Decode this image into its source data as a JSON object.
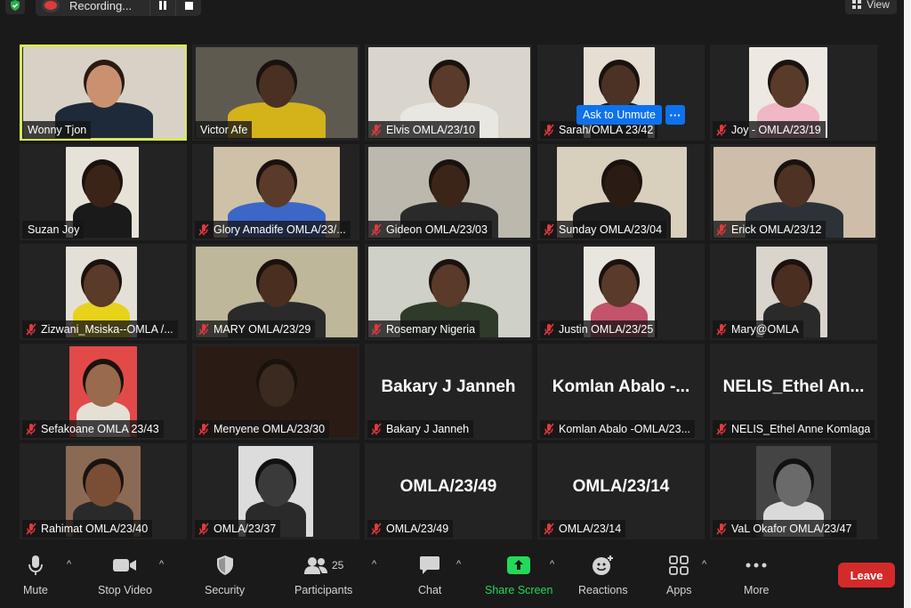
{
  "top_bar": {
    "recording_label": "Recording...",
    "view_label": "View"
  },
  "participants": [
    {
      "name": "Wonny Tjon",
      "muted": false,
      "active": true
    },
    {
      "name": "Victor Afe",
      "muted": false
    },
    {
      "name": "Elvis OMLA/23/10",
      "muted": true
    },
    {
      "name": "Sarah/OMLA 23/42",
      "muted": true
    },
    {
      "name": "Joy - OMLA/23/19",
      "muted": true
    },
    {
      "name": "Suzan Joy",
      "muted": false
    },
    {
      "name": "Glory Amadife OMLA/23/...",
      "muted": true
    },
    {
      "name": "Gideon OMLA/23/03",
      "muted": true
    },
    {
      "name": "Sunday OMLA/23/04",
      "muted": true
    },
    {
      "name": "Erick OMLA/23/12",
      "muted": true
    },
    {
      "name": "Zizwani_Msiska--OMLA /...",
      "muted": true
    },
    {
      "name": "MARY OMLA/23/29",
      "muted": true
    },
    {
      "name": "Rosemary  Nigeria",
      "muted": true
    },
    {
      "name": "Justin OMLA/23/25",
      "muted": true
    },
    {
      "name": "Mary@OMLA",
      "muted": true
    },
    {
      "name": "Sefakoane OMLA 23/43",
      "muted": true
    },
    {
      "name": "Menyene OMLA/23/30",
      "muted": true
    },
    {
      "name": "Bakary J Janneh",
      "muted": true,
      "big_name": "Bakary J Janneh"
    },
    {
      "name": "Komlan Abalo -OMLA/23...",
      "muted": true,
      "big_name": "Komlan  Abalo  -..."
    },
    {
      "name": "NELIS_Ethel Anne Komlaga",
      "muted": true,
      "big_name": "NELIS_Ethel  An..."
    },
    {
      "name": "Rahimat OMLA/23/40",
      "muted": true
    },
    {
      "name": "OMLA/23/37",
      "muted": true
    },
    {
      "name": "OMLA/23/49",
      "muted": true,
      "big_name": "OMLA/23/49"
    },
    {
      "name": "OMLA/23/14",
      "muted": true,
      "big_name": "OMLA/23/14"
    },
    {
      "name": "VaL Okafor  OMLA/23/47",
      "muted": true
    }
  ],
  "tooltip": {
    "ask_to_unmute": "Ask to Unmute",
    "more": "···"
  },
  "toolbar": {
    "mute": "Mute",
    "stop_video": "Stop Video",
    "security": "Security",
    "participants": "Participants",
    "participants_count": "25",
    "chat": "Chat",
    "share_screen": "Share Screen",
    "reactions": "Reactions",
    "apps": "Apps",
    "more": "More",
    "leave": "Leave"
  },
  "colors": {
    "background": "#1a1a1a",
    "tile": "#232323",
    "active_speaker": "#d9e85a",
    "share_green": "#23d959",
    "leave_red": "#d42a2a",
    "muted_red": "#e0393e",
    "unmute_blue": "#0e72ed"
  }
}
